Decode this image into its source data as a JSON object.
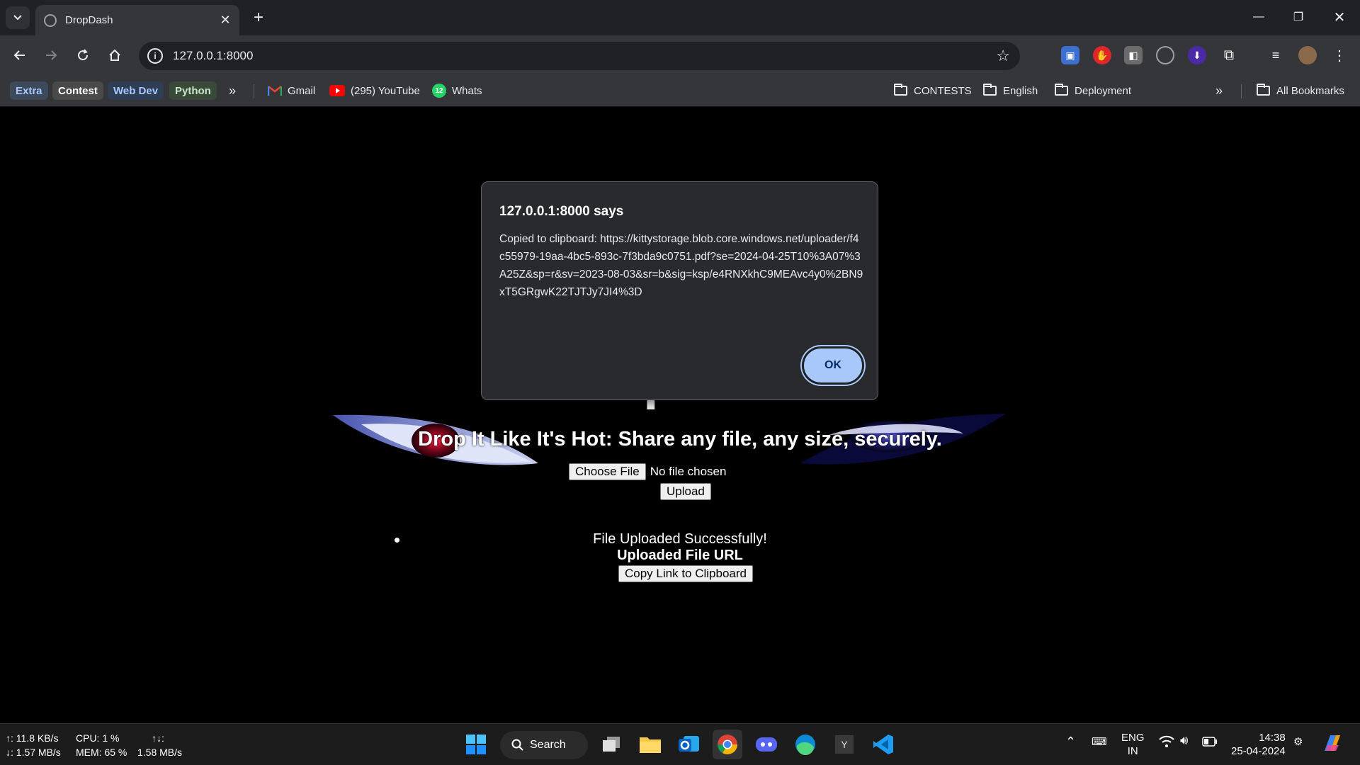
{
  "browser": {
    "tab_title": "DropDash",
    "url": "127.0.0.1:8000",
    "bookmarks": {
      "chips": [
        {
          "label": "Extra",
          "color": "#3c4a5c"
        },
        {
          "label": "Contest",
          "color": "#4a4a4a"
        },
        {
          "label": "Web Dev",
          "color": "#2f3d55"
        },
        {
          "label": "Python",
          "color": "#3a4a3a"
        }
      ],
      "gmail": "Gmail",
      "youtube": "(295) YouTube",
      "whatsapp": "Whats",
      "whatsapp_badge": "12",
      "folders": [
        "CONTESTS",
        "English",
        "Deployment"
      ],
      "all_bookmarks": "All Bookmarks"
    }
  },
  "dialog": {
    "title": "127.0.0.1:8000 says",
    "message": "Copied to clipboard: https://kittystorage.blob.core.windows.net/uploader/f4c55979-19aa-4bc5-893c-7f3bda9c0751.pdf?se=2024-04-25T10%3A07%3A25Z&sp=r&sv=2023-08-03&sr=b&sig=ksp/e4RNXkhC9MEAvc4y0%2BN9xT5GRgwK22TJTJy7JI4%3D",
    "ok_label": "OK"
  },
  "page": {
    "title": "DropDash",
    "tagline": "Drop It Like It's Hot: Share any file, any size, securely.",
    "choose_file_label": "Choose File",
    "no_file_text": "No file chosen",
    "upload_label": "Upload",
    "success_text": "File Uploaded Successfully!",
    "url_heading": "Uploaded File URL",
    "copy_label": "Copy Link to Clipboard"
  },
  "taskbar": {
    "net_up": "↑: 11.8 KB/s",
    "net_down": "↓: 1.57 MB/s",
    "cpu": "CPU: 1 %",
    "mem": "MEM: 65 %",
    "io_label": "↑↓:",
    "io_value": "1.58 MB/s",
    "search_label": "Search",
    "lang_top": "ENG",
    "lang_bottom": "IN",
    "time": "14:38",
    "date": "25-04-2024"
  }
}
